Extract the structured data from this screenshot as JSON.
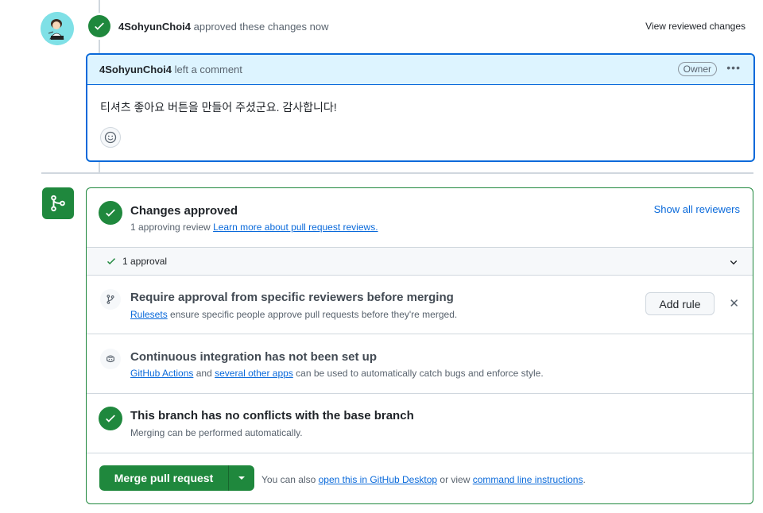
{
  "review_event": {
    "author": "4SohyunChoi4",
    "action_text": "approved these changes now",
    "view_reviewed_label": "View reviewed changes"
  },
  "comment": {
    "author": "4SohyunChoi4",
    "action_text": "left a comment",
    "owner_badge": "Owner",
    "body": "티셔츠 좋아요 버튼을 만들어 주셨군요. 감사합니다!"
  },
  "merge_box": {
    "approved": {
      "title": "Changes approved",
      "subtitle_prefix": "1 approving review",
      "learn_more_link": "Learn more about pull request reviews.",
      "show_all_label": "Show all reviewers",
      "approvals_label": "1 approval"
    },
    "rule": {
      "title": "Require approval from specific reviewers before merging",
      "link": "Rulesets",
      "text": "ensure specific people approve pull requests before they're merged.",
      "button_label": "Add rule"
    },
    "ci": {
      "title": "Continuous integration has not been set up",
      "link1": "GitHub Actions",
      "and": "and",
      "link2": "several other apps",
      "text": "can be used to automatically catch bugs and enforce style."
    },
    "conflicts": {
      "title": "This branch has no conflicts with the base branch",
      "subtitle": "Merging can be performed automatically."
    },
    "merge": {
      "button_label": "Merge pull request",
      "note_prefix": "You can also",
      "desktop_link": "open this in GitHub Desktop",
      "or_view": "or view",
      "cli_link": "command line instructions",
      "period": "."
    }
  },
  "colors": {
    "success": "#1f883d",
    "accent": "#0969da",
    "header_bg": "#ddf4ff"
  }
}
